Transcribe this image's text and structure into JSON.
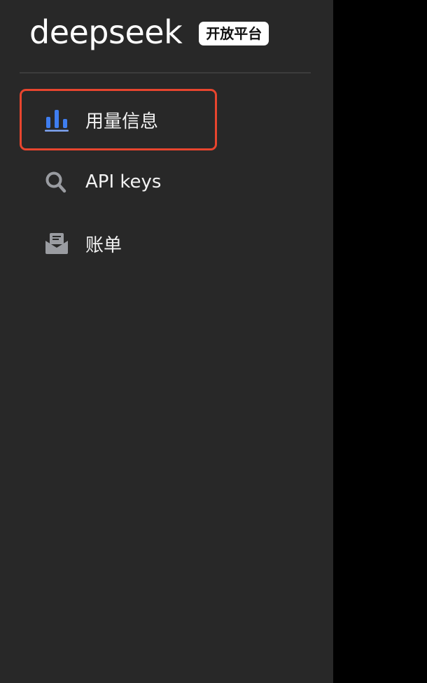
{
  "brand": {
    "logo_text": "deepseek",
    "badge": "开放平台"
  },
  "colors": {
    "sidebar_bg": "#282828",
    "outer_bg": "#000000",
    "active_icon": "#3f7ef0",
    "inactive_icon": "#9a9ca1",
    "highlight_border": "#e8452e"
  },
  "nav": {
    "items": [
      {
        "label": "用量信息",
        "icon": "bar-chart-icon",
        "active": true
      },
      {
        "label": "API keys",
        "icon": "key-search-icon",
        "active": false
      },
      {
        "label": "账单",
        "icon": "mail-inbox-icon",
        "active": false
      }
    ]
  }
}
